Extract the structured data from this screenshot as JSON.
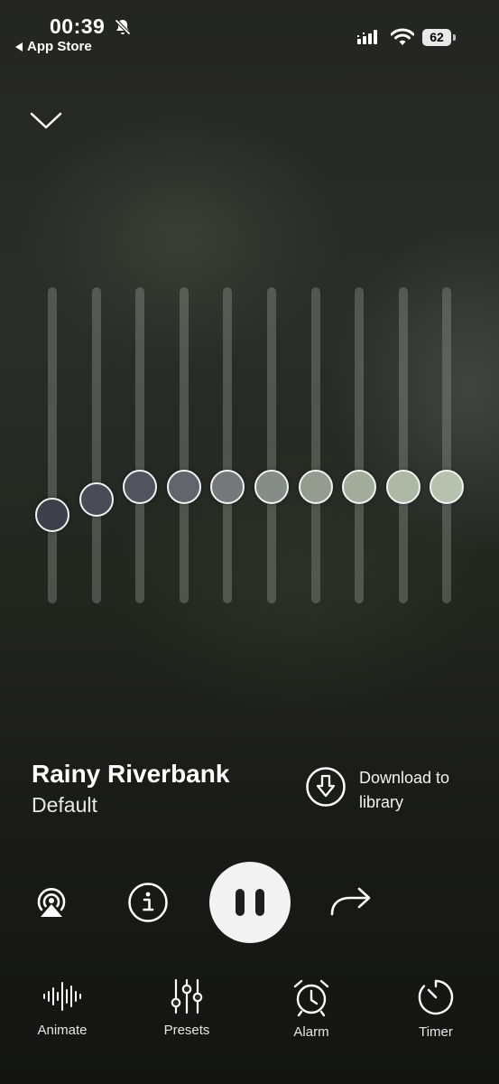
{
  "status": {
    "time": "00:39",
    "back_label": "App Store",
    "battery": "62"
  },
  "mixer": {
    "channels": [
      {
        "level": 0.28,
        "color": "#3f3f4c"
      },
      {
        "level": 0.33,
        "color": "#4a4b56"
      },
      {
        "level": 0.37,
        "color": "#52535e"
      },
      {
        "level": 0.37,
        "color": "#63656c"
      },
      {
        "level": 0.37,
        "color": "#74787a"
      },
      {
        "level": 0.37,
        "color": "#868c86"
      },
      {
        "level": 0.37,
        "color": "#949c90"
      },
      {
        "level": 0.37,
        "color": "#a2ad9b"
      },
      {
        "level": 0.37,
        "color": "#adb9a5"
      },
      {
        "level": 0.37,
        "color": "#b6c2ad"
      }
    ]
  },
  "track": {
    "title": "Rainy Riverbank",
    "subtitle": "Default"
  },
  "download": {
    "label": "Download to library",
    "icon": "download-circle-icon"
  },
  "controls": {
    "airplay_icon": "airplay-icon",
    "info_icon": "info-icon",
    "play_state": "playing",
    "share_icon": "share-arrow-icon"
  },
  "tabs": [
    {
      "label": "Animate",
      "icon": "waveform-icon"
    },
    {
      "label": "Presets",
      "icon": "sliders-icon"
    },
    {
      "label": "Alarm",
      "icon": "alarm-clock-icon"
    },
    {
      "label": "Timer",
      "icon": "timer-icon"
    }
  ]
}
